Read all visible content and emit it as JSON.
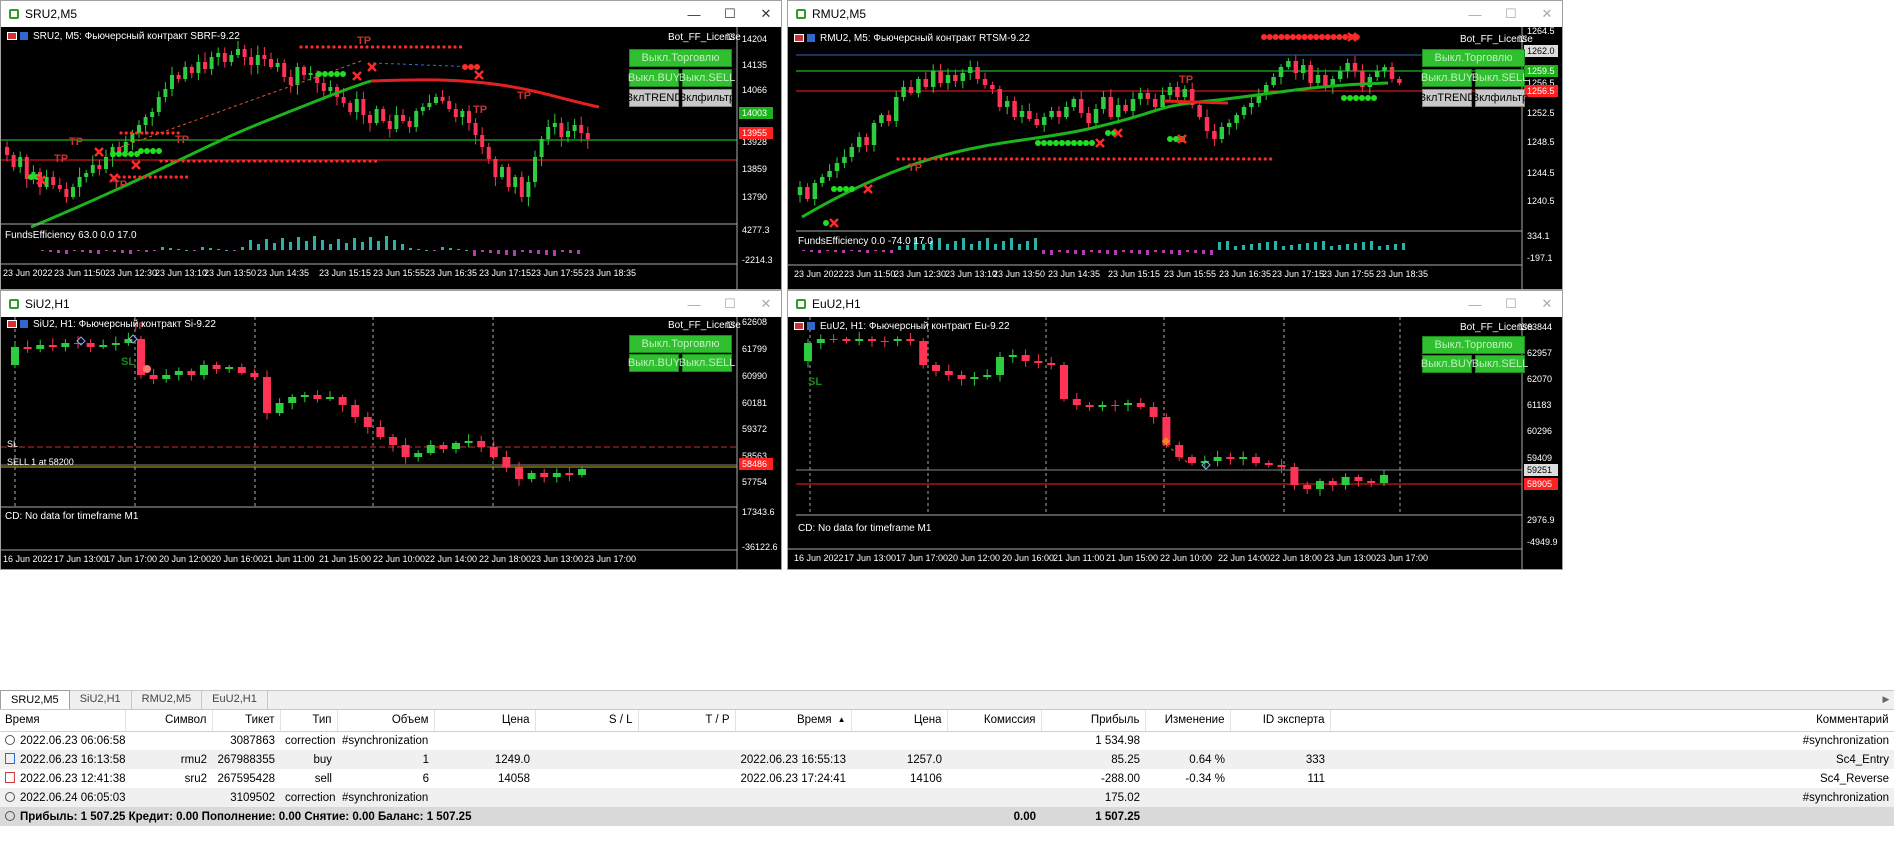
{
  "tabs": [
    "SRU2,M5",
    "SiU2,H1",
    "RMU2,M5",
    "EuU2,H1"
  ],
  "grid": {
    "headers": {
      "time": "Время",
      "symbol": "Символ",
      "ticket": "Тикет",
      "type": "Тип",
      "volume": "Объем",
      "price": "Цена",
      "sl": "S / L",
      "tp": "T / P",
      "time_close": "Время",
      "price_close": "Цена",
      "commission": "Комиссия",
      "profit": "Прибыль",
      "change": "Изменение",
      "expert_id": "ID эксперта",
      "comment": "Комментарий"
    },
    "sort_indicator": "▲",
    "rows": [
      {
        "kind": "sync",
        "time": "2022.06.23 06:06:58",
        "symbol": "",
        "ticket": "3087863",
        "type": "correction",
        "volume": "#synchronization",
        "price": "",
        "sl": "",
        "tp": "",
        "time_close": "",
        "price_close": "",
        "commission": "",
        "profit": "1 534.98",
        "change": "",
        "expert_id": "",
        "comment": "#synchronization"
      },
      {
        "kind": "buy",
        "time": "2022.06.23 16:13:58",
        "symbol": "rmu2",
        "ticket": "267988355",
        "type": "buy",
        "volume": "1",
        "price": "1249.0",
        "sl": "",
        "tp": "",
        "time_close": "2022.06.23 16:55:13",
        "price_close": "1257.0",
        "commission": "",
        "profit": "85.25",
        "change": "0.64 %",
        "expert_id": "333",
        "comment": "Sc4_Entry",
        "profit_color": "blue"
      },
      {
        "kind": "sell",
        "time": "2022.06.23 12:41:38",
        "symbol": "sru2",
        "ticket": "267595428",
        "type": "sell",
        "volume": "6",
        "price": "14058",
        "sl": "",
        "tp": "",
        "time_close": "2022.06.23 17:24:41",
        "price_close": "14106",
        "commission": "",
        "profit": "-288.00",
        "change": "-0.34 %",
        "expert_id": "111",
        "comment": "Sc4_Reverse",
        "profit_color": "red"
      },
      {
        "kind": "sync",
        "time": "2022.06.24 06:05:03",
        "symbol": "",
        "ticket": "3109502",
        "type": "correction",
        "volume": "#synchronization",
        "price": "",
        "sl": "",
        "tp": "",
        "time_close": "",
        "price_close": "",
        "commission": "",
        "profit": "175.02",
        "change": "",
        "expert_id": "",
        "comment": "#synchronization"
      }
    ],
    "summary": {
      "text": "Прибыль: 1 507.25  Кредит: 0.00  Пополнение: 0.00  Снятие: 0.00  Баланс: 1 507.25",
      "commission": "0.00",
      "profit": "1 507.25"
    }
  },
  "colors": {
    "bull": "#2ecc40",
    "bear": "#ff3355",
    "red_line": "#ff2020",
    "green_line": "#1db31d",
    "slate": "#2fb0a8",
    "magenta": "#b13cb1",
    "dot_red": "#ff2a2a",
    "dot_green": "#22dd22"
  },
  "charts": [
    {
      "id": "sru2",
      "title": "SRU2,M5",
      "caption": "SRU2, M5:  Фьючерсный контракт SBRF-9.22",
      "bot_label": "Bot_FF_License",
      "buttons": {
        "trade": "Выкл.Торговлю",
        "buy": "Выкл.BUY",
        "sell": "Выкл.SELL",
        "trend": "ВклTREND",
        "filter": "Вклфильтр"
      },
      "ind_caption": "FundsEfficiency 63.0 0.0 17.0",
      "price_ticks": [
        "14204",
        "14135",
        "14066",
        "13997",
        "13928",
        "13859",
        "13790"
      ],
      "price_badges": [
        "14003",
        "13955"
      ],
      "ind_ticks": [
        "4277.3",
        "-2214.3"
      ],
      "time_labels": [
        "23 Jun 2022",
        "23 Jun 11:50",
        "23 Jun 12:30",
        "23 Jun 13:10",
        "23 Jun 13:50",
        "23 Jun 14:35",
        "23 Jun 15:15",
        "23 Jun 15:55",
        "23 Jun 16:35",
        "23 Jun 17:15",
        "23 Jun 17:55",
        "23 Jun 18:35"
      ],
      "tp_labels": [
        "TP",
        "TP",
        "TP",
        "TP",
        "TP",
        "TP",
        "TP"
      ]
    },
    {
      "id": "rmu2",
      "title": "RMU2,M5",
      "caption": "RMU2, M5:  Фьючерсный контракт RTSM-9.22",
      "bot_label": "Bot_FF_License",
      "buttons": {
        "trade": "Выкл.Торговлю",
        "buy": "Выкл.BUY",
        "sell": "Выкл.SELL",
        "trend": "ВклTREND",
        "filter": "Вклфильтр"
      },
      "ind_caption": "FundsEfficiency 0.0 -74.0 17.0",
      "price_ticks": [
        "1264.5",
        "1262.0",
        "1260.5",
        "1259.5",
        "1256.5",
        "1256.5",
        "1252.5",
        "1248.5",
        "1244.5",
        "1240.5"
      ],
      "price_badges": [
        "1262.0",
        "1259.5",
        "1256.5"
      ],
      "ind_ticks": [
        "334.1",
        "-197.1"
      ],
      "time_labels": [
        "23 Jun 2022",
        "23 Jun 11:50",
        "23 Jun 12:30",
        "23 Jun 13:10",
        "23 Jun 13:50",
        "23 Jun 14:35",
        "23 Jun 15:15",
        "23 Jun 15:55",
        "23 Jun 16:35",
        "23 Jun 17:15",
        "23 Jun 17:55",
        "23 Jun 18:35"
      ],
      "tp_labels": [
        "TP",
        "TP"
      ]
    },
    {
      "id": "siu2",
      "title": "SiU2,H1",
      "caption": "SiU2, H1:  Фьючерсный контракт Si-9.22",
      "bot_label": "Bot_FF_License",
      "buttons": {
        "trade": "Выкл.Торговлю",
        "buy": "Выкл.BUY",
        "sell": "Выкл.SELL"
      },
      "ind_caption": "CD: No data for timeframe M1",
      "price_ticks": [
        "62608",
        "61799",
        "60990",
        "60181",
        "59372",
        "58563",
        "57754"
      ],
      "price_badges": [
        "58486"
      ],
      "ind_ticks": [
        "17343.6",
        "-36122.6"
      ],
      "time_labels": [
        "16 Jun 2022",
        "17 Jun 13:00",
        "17 Jun 17:00",
        "20 Jun 12:00",
        "20 Jun 16:00",
        "21 Jun 11:00",
        "21 Jun 15:00",
        "22 Jun 10:00",
        "22 Jun 14:00",
        "22 Jun 18:00",
        "23 Jun 13:00",
        "23 Jun 17:00"
      ],
      "sl_label": "SL",
      "sell_label": "SELL 1 at 58200",
      "sl_small": "SL",
      "tp_small": "TP"
    },
    {
      "id": "euu2",
      "title": "EuU2,H1",
      "caption": "EuU2, H1:  Фьючерсный контракт Eu-9.22",
      "bot_label": "Bot_FF_License",
      "buttons": {
        "trade": "Выкл.Торговлю",
        "buy": "Выкл.BUY",
        "sell": "Выкл.SELL"
      },
      "ind_caption": "CD: No data for timeframe M1",
      "price_ticks": [
        "63844",
        "62957",
        "62070",
        "61183",
        "60296",
        "59409",
        "58522"
      ],
      "price_badges": [
        "59251",
        "58905"
      ],
      "ind_ticks": [
        "2976.9",
        "-4949.9"
      ],
      "time_labels": [
        "16 Jun 2022",
        "17 Jun 13:00",
        "17 Jun 17:00",
        "20 Jun 12:00",
        "20 Jun 16:00",
        "21 Jun 11:00",
        "21 Jun 15:00",
        "22 Jun 10:00",
        "22 Jun 14:00",
        "22 Jun 18:00",
        "23 Jun 13:00",
        "23 Jun 17:00"
      ],
      "sl_small": "SL"
    }
  ]
}
